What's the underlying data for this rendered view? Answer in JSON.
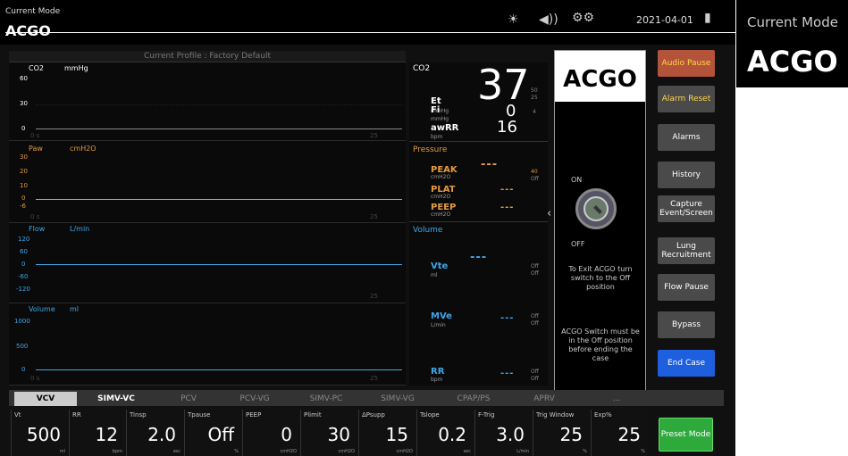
{
  "header": {
    "mode_caption": "Current Mode",
    "mode_value": "ACGO",
    "date": "2021-04-01"
  },
  "inset": {
    "caption": "Current Mode",
    "value": "ACGO"
  },
  "profile": "Current Profile : Factory Default",
  "waves": [
    {
      "name": "CO2",
      "unit": "mmHg",
      "ticks": [
        "60",
        "30",
        "0"
      ],
      "color": "#fff"
    },
    {
      "name": "Paw",
      "unit": "cmH2O",
      "ticks": [
        "30",
        "20",
        "10",
        "0",
        "-6"
      ],
      "color": "#e39b3d"
    },
    {
      "name": "Flow",
      "unit": "L/min",
      "ticks": [
        "120",
        "60",
        "0",
        "-60",
        "-120"
      ],
      "color": "#3fa6e8"
    },
    {
      "name": "Volume",
      "unit": "ml",
      "ticks": [
        "1000",
        "500",
        "0"
      ],
      "color": "#3fa6e8"
    }
  ],
  "wave_axis": {
    "start": "0 s",
    "end": "25"
  },
  "co2": {
    "header": "CO2",
    "et_label": "Et",
    "et_unit": "mmHg",
    "et_value": "37",
    "et_lim_hi": "50",
    "et_lim_lo": "25",
    "fi_label": "Fi",
    "fi_unit": "mmHg",
    "fi_value": "0",
    "fi_lim": "4",
    "awrr_label": "awRR",
    "awrr_unit": "bpm",
    "awrr_value": "16"
  },
  "pressure": {
    "header": "Pressure",
    "peak_label": "PEAK",
    "peak_unit": "cmH2O",
    "peak_value": "---",
    "peak_lim_hi": "40",
    "peak_lim_lo": "Off",
    "plat_label": "PLAT",
    "plat_unit": "cmH2O",
    "plat_value": "---",
    "peep_label": "PEEP",
    "peep_unit": "cmH2O",
    "peep_value": "---"
  },
  "volume": {
    "header": "Volume",
    "vte_label": "Vte",
    "vte_unit": "ml",
    "vte_value": "---",
    "vte_lim": "Off",
    "vte_lim2": "Off",
    "mve_label": "MVe",
    "mve_unit": "L/min",
    "mve_value": "---",
    "mve_lim": "Off",
    "mve_lim2": "Off",
    "rr_label": "RR",
    "rr_unit": "bpm",
    "rr_value": "---",
    "rr_lim": "Off",
    "rr_lim2": "Off"
  },
  "acgo": {
    "title": "ACGO",
    "on": "ON",
    "off": "OFF",
    "msg1": "To Exit ACGO turn switch to the Off position",
    "msg2": "ACGO Switch must be in the Off position before ending the case"
  },
  "buttons": [
    "Audio Pause",
    "Alarm Reset",
    "Alarms",
    "History",
    "Capture Event/Screen",
    "Lung Recruitment",
    "Flow Pause",
    "Bypass",
    "End Case"
  ],
  "tabs": [
    "VCV",
    "SIMV-VC",
    "PCV",
    "PCV-VG",
    "SIMV-PC",
    "SIMV-VG",
    "CPAP/PS",
    "APRV",
    "..."
  ],
  "params": [
    {
      "label": "Vt",
      "value": "500",
      "unit": "ml"
    },
    {
      "label": "RR",
      "value": "12",
      "unit": "bpm"
    },
    {
      "label": "Tinsp",
      "value": "2.0",
      "unit": "sec"
    },
    {
      "label": "Tpause",
      "value": "Off",
      "unit": "%"
    },
    {
      "label": "PEEP",
      "value": "0",
      "unit": "cmH2O"
    },
    {
      "label": "Plimit",
      "value": "30",
      "unit": "cmH2O"
    },
    {
      "label": "ΔPsupp",
      "value": "15",
      "unit": "cmH2O"
    },
    {
      "label": "Tslope",
      "value": "0.2",
      "unit": "sec"
    },
    {
      "label": "F-Trig",
      "value": "3.0",
      "unit": "L/min"
    },
    {
      "label": "Trig Window",
      "value": "25",
      "unit": "%"
    },
    {
      "label": "Exp%",
      "value": "25",
      "unit": "%"
    }
  ],
  "preset": "Preset Mode"
}
